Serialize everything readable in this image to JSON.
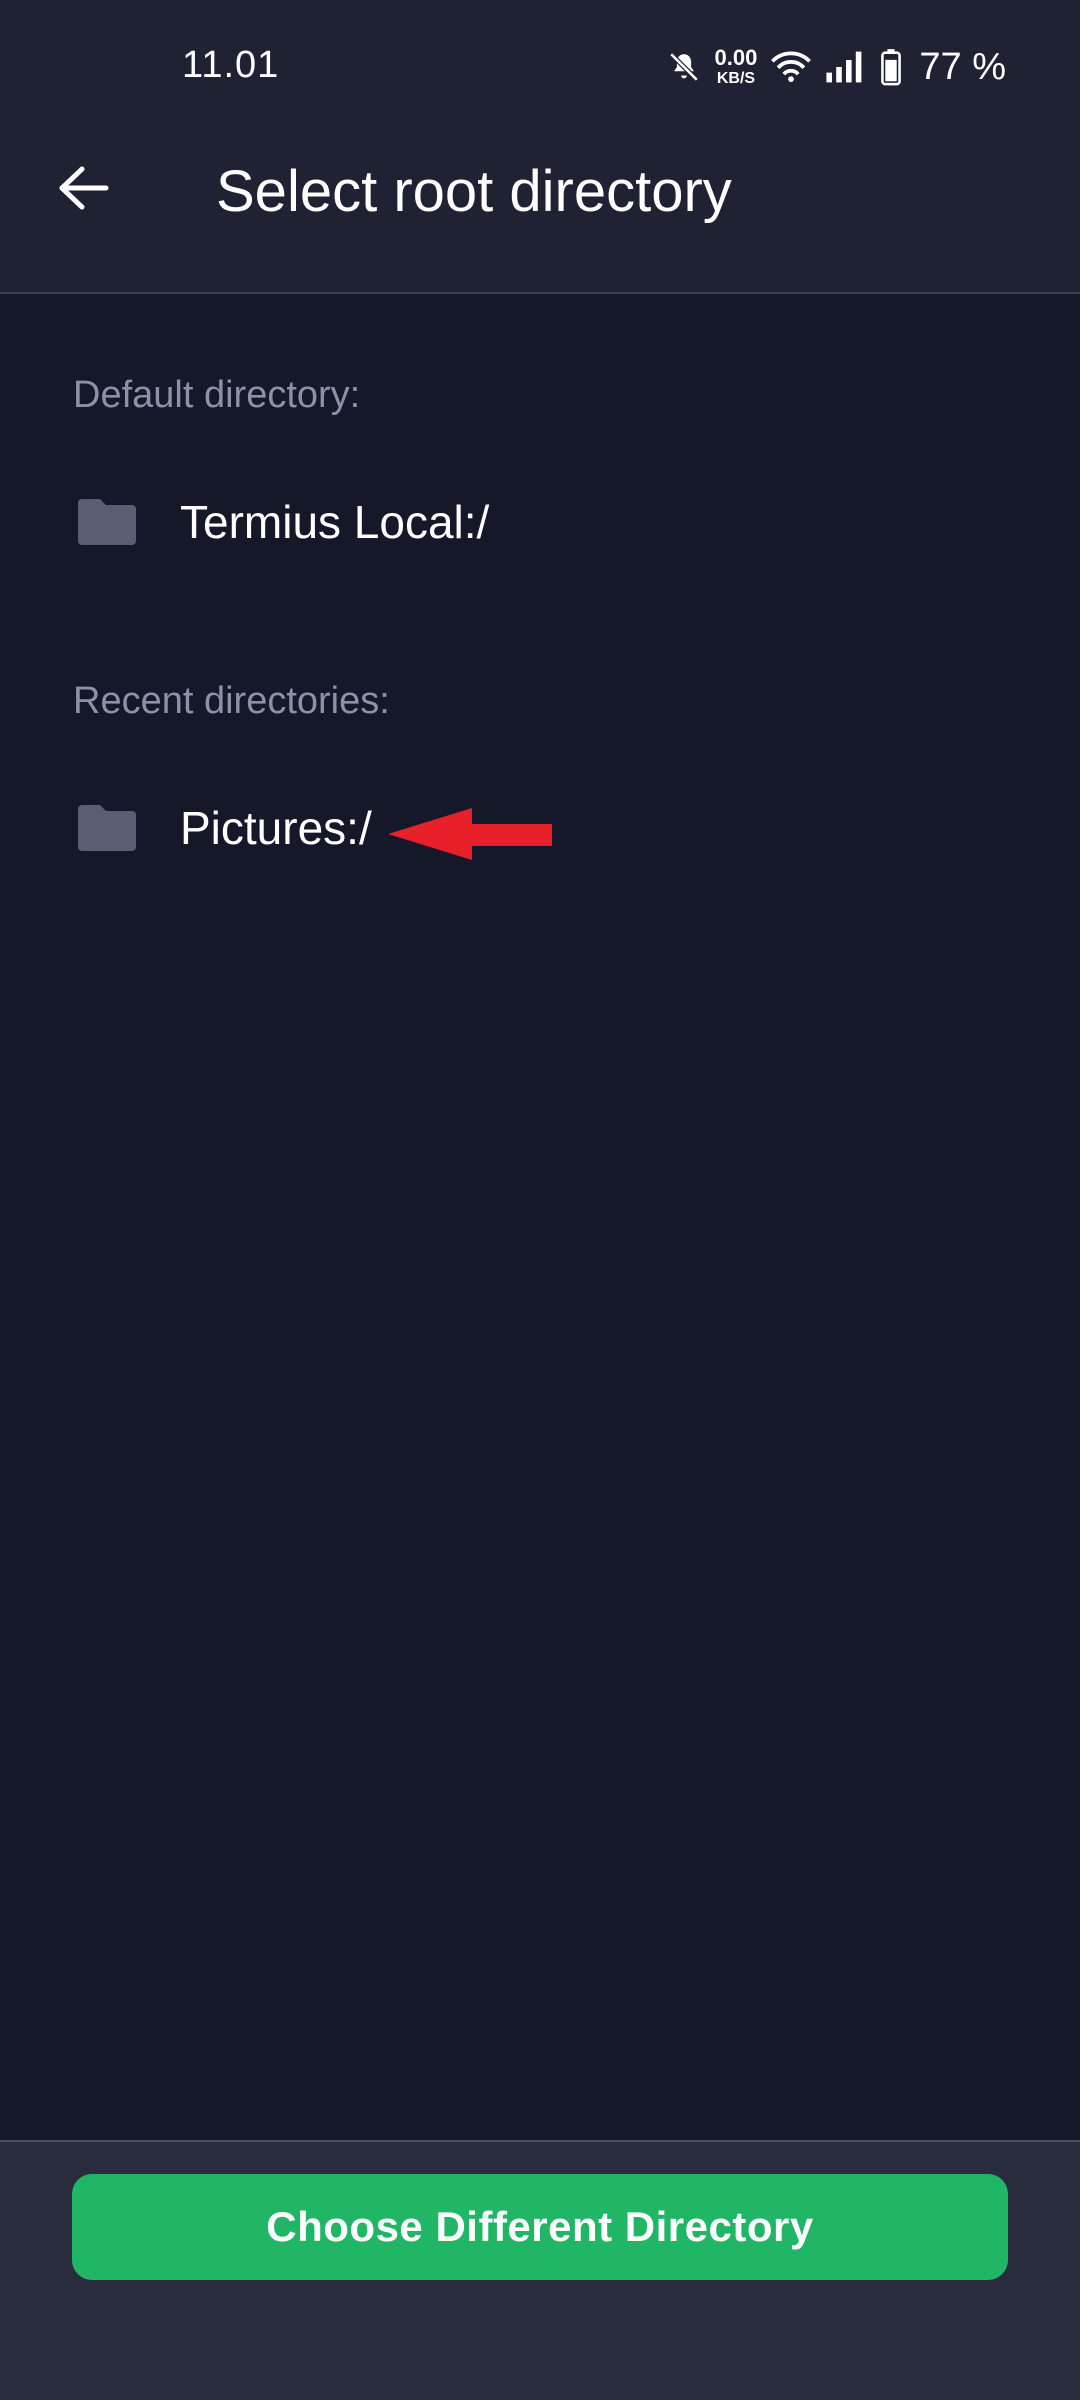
{
  "status_bar": {
    "time": "11.01",
    "net_speed_value": "0.00",
    "net_speed_unit": "KB/S",
    "battery": "77 %",
    "icons": [
      "bell-muted-icon",
      "wifi-icon",
      "signal-icon",
      "battery-icon"
    ]
  },
  "app_bar": {
    "back_icon": "back-arrow-icon",
    "title": "Select root directory"
  },
  "sections": {
    "default_label": "Default directory:",
    "default_dir": "Termius Local:/",
    "recent_label": "Recent directories:",
    "recent_dirs": [
      "Pictures:/"
    ]
  },
  "annotation": {
    "icon": "red-arrow-annotation",
    "color": "#e8202a"
  },
  "bottom": {
    "button_label": "Choose Different Directory"
  },
  "colors": {
    "background": "#151829",
    "top_bar": "#1f2233",
    "bottom_bar": "#292c3d",
    "accent": "#21b566",
    "muted_text": "#8d91a6",
    "folder": "#5a5e72"
  }
}
